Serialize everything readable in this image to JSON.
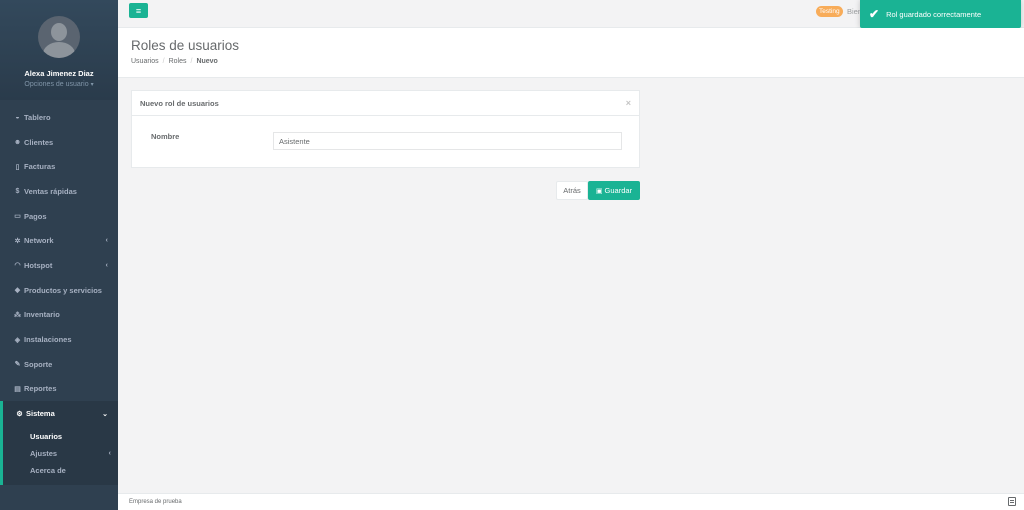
{
  "user": {
    "name": "Alexa Jimenez Diaz",
    "options_label": "Opciones de usuario"
  },
  "nav": {
    "items": [
      {
        "label": "Tablero",
        "icon": "dashboard-icon"
      },
      {
        "label": "Clientes",
        "icon": "users-icon"
      },
      {
        "label": "Facturas",
        "icon": "file-icon"
      },
      {
        "label": "Ventas rápidas",
        "icon": "dollar-icon"
      },
      {
        "label": "Pagos",
        "icon": "money-icon"
      },
      {
        "label": "Network",
        "icon": "network-icon"
      },
      {
        "label": "Hotspot",
        "icon": "wifi-icon"
      },
      {
        "label": "Productos y servicios",
        "icon": "tags-icon"
      },
      {
        "label": "Inventario",
        "icon": "cubes-icon"
      },
      {
        "label": "Instalaciones",
        "icon": "tools-icon"
      },
      {
        "label": "Soporte",
        "icon": "wrench-icon"
      },
      {
        "label": "Reportes",
        "icon": "book-icon"
      },
      {
        "label": "Sistema",
        "icon": "cogs-icon"
      }
    ],
    "sub_items": [
      {
        "label": "Usuarios"
      },
      {
        "label": "Ajustes"
      },
      {
        "label": "Acerca de"
      }
    ]
  },
  "topbar": {
    "testing_badge": "Testing",
    "welcome_text": "Bien"
  },
  "toast": {
    "message": "Rol guardado correctamente"
  },
  "page": {
    "title": "Roles de usuarios",
    "breadcrumb": [
      "Usuarios",
      "Roles",
      "Nuevo"
    ]
  },
  "panel": {
    "title": "Nuevo rol de usuarios",
    "field_label": "Nombre",
    "field_value": "Asistente"
  },
  "buttons": {
    "back": "Atrás",
    "save": "Guardar"
  },
  "footer": {
    "text": "Empresa de prueba"
  },
  "colors": {
    "sidebar": "#2f4050",
    "accent": "#1ab394",
    "badge": "#f8ac59"
  }
}
